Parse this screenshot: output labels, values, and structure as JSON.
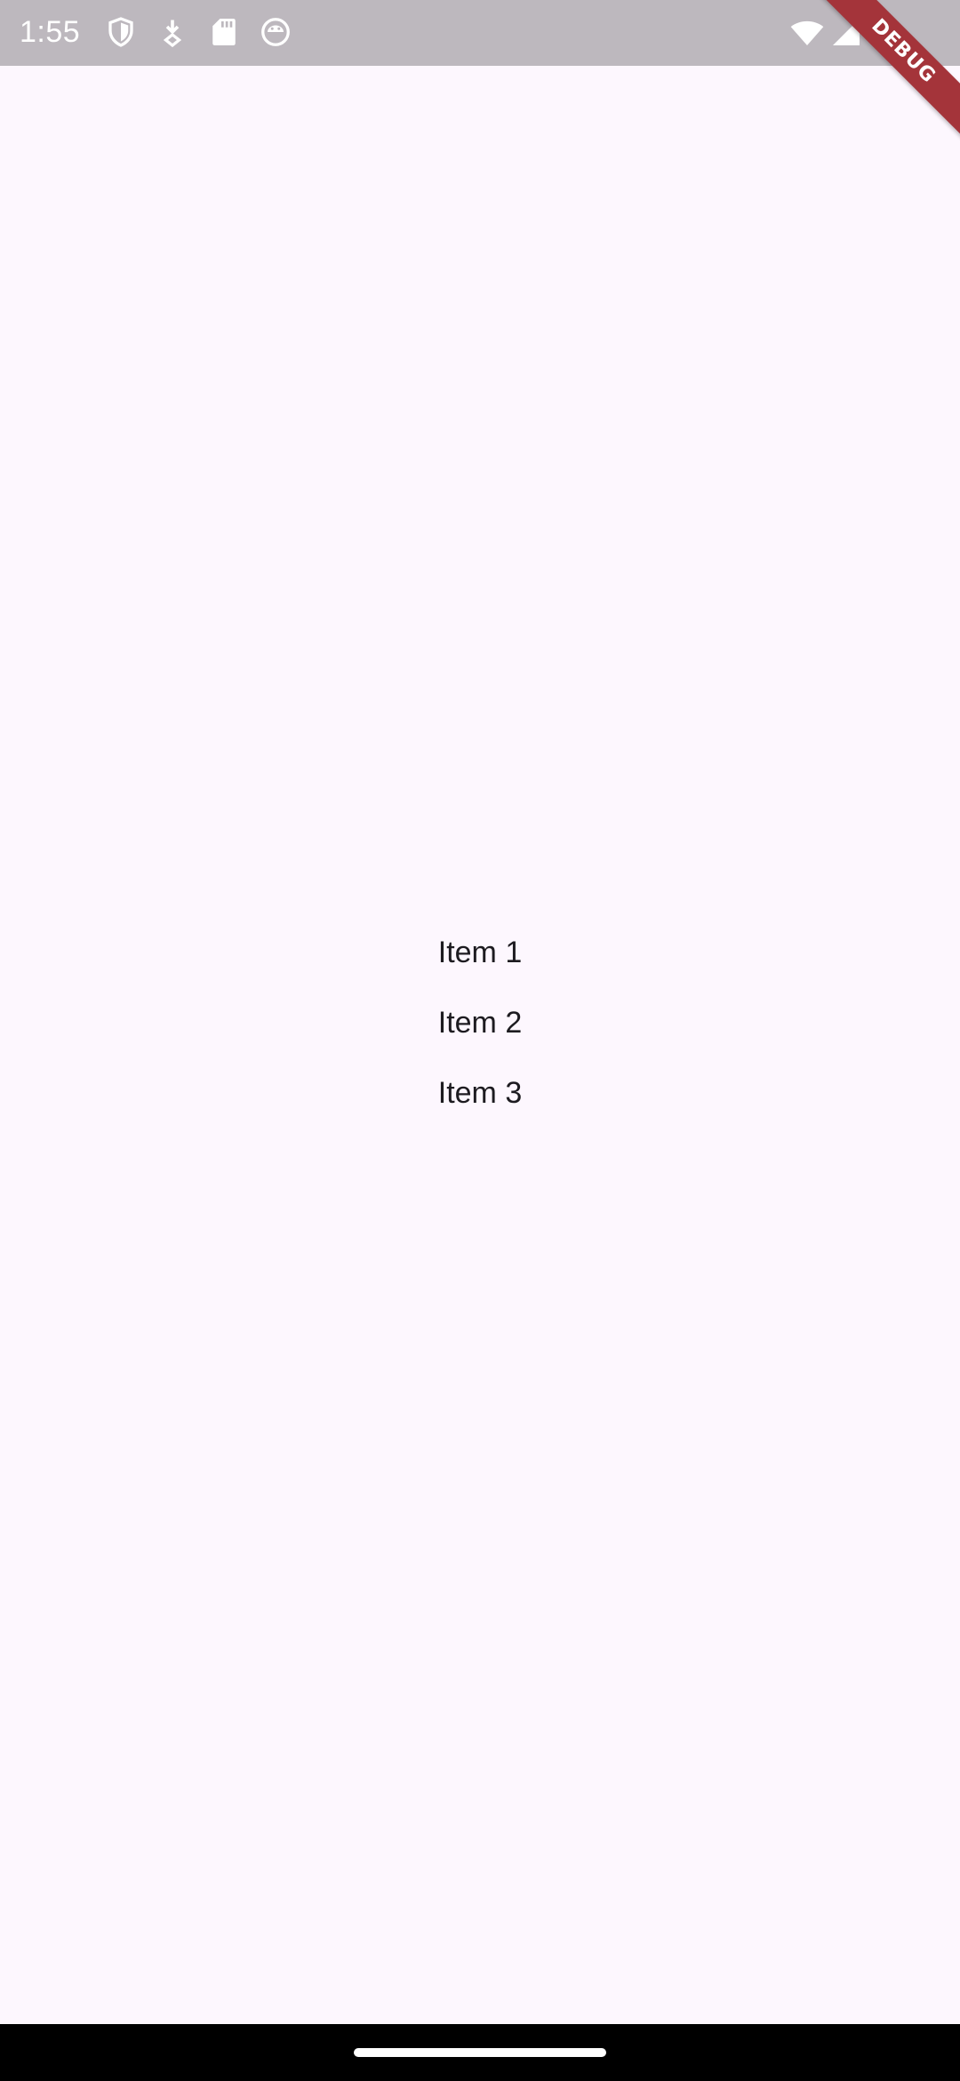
{
  "status_bar": {
    "time": "1:55",
    "left_icons": [
      "shield-icon",
      "download-icon",
      "sd-card-icon",
      "robot-icon"
    ],
    "right_icons": [
      "wifi-icon",
      "signal-icon",
      "battery-icon"
    ]
  },
  "debug_banner": {
    "label": "DEBUG"
  },
  "list": {
    "items": [
      {
        "label": "Item 1"
      },
      {
        "label": "Item 2"
      },
      {
        "label": "Item 3"
      }
    ]
  },
  "colors": {
    "background": "#FDF7FE",
    "status_bar": "#BDB8BE",
    "text": "#1D1B20",
    "debug_banner": "#A4343A",
    "nav_bar": "#000000"
  }
}
